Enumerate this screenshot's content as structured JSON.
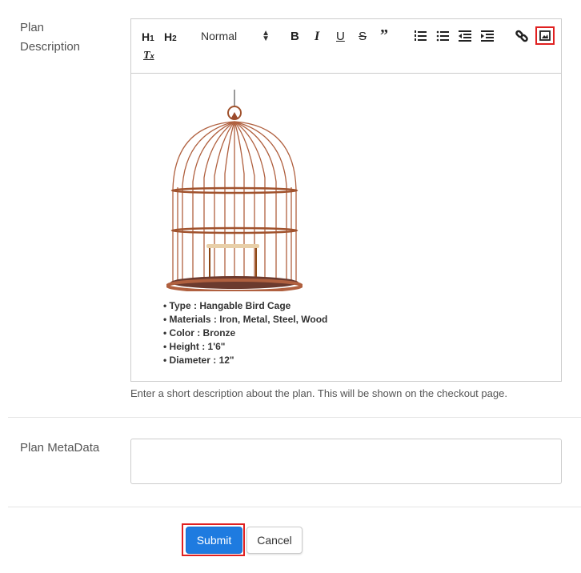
{
  "form": {
    "description": {
      "label_line1": "Plan",
      "label_line2": "Description",
      "help_text": "Enter a short description about the plan. This will be shown on the checkout page."
    },
    "metadata": {
      "label": "Plan MetaData",
      "value": "",
      "placeholder": ""
    }
  },
  "toolbar": {
    "h1": "H1",
    "h2": "H2",
    "format_select": "Normal",
    "icons": [
      "bold-icon",
      "italic-icon",
      "underline-icon",
      "strikethrough-icon",
      "blockquote-icon",
      "ordered-list-icon",
      "bullet-list-icon",
      "outdent-icon",
      "indent-icon",
      "link-icon",
      "image-icon",
      "clear-format-icon"
    ],
    "highlighted": "image-icon"
  },
  "editor_content": {
    "image": "bird-cage-image",
    "specs": [
      "Type : Hangable Bird Cage",
      "Materials : Iron, Metal, Steel, Wood",
      "Color : Bronze",
      "Height : 1'6\"",
      "Diameter : 12\""
    ]
  },
  "actions": {
    "submit": "Submit",
    "cancel": "Cancel"
  },
  "colors": {
    "primary": "#1e7be0",
    "highlight": "#e02020",
    "cage": "#b0603f"
  }
}
